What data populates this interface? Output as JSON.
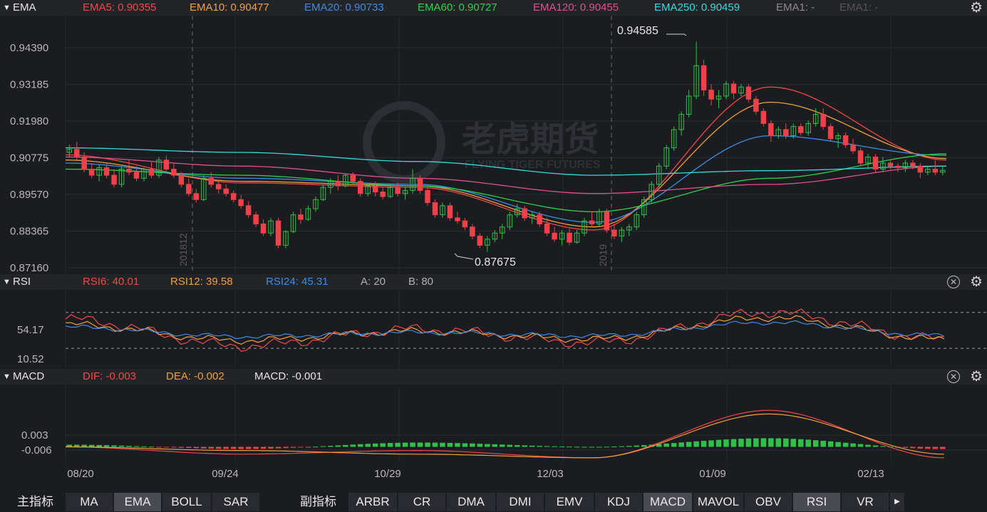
{
  "main_panel": {
    "name": "EMA",
    "indicators": [
      {
        "label": "EMA5: 0.90355",
        "color": "#f04848"
      },
      {
        "label": "EMA10: 0.90477",
        "color": "#f0a03c"
      },
      {
        "label": "EMA20: 0.90733",
        "color": "#3c8ce6"
      },
      {
        "label": "EMA60: 0.90727",
        "color": "#2fd04a"
      },
      {
        "label": "EMA120: 0.90455",
        "color": "#e0508c"
      },
      {
        "label": "EMA250: 0.90459",
        "color": "#38d8e0"
      },
      {
        "label": "EMA1: -",
        "color": "#8a8a8a"
      },
      {
        "label": "EMA1: -",
        "color": "#555555"
      }
    ],
    "y_ticks": [
      "0.94390",
      "0.93185",
      "0.91980",
      "0.90775",
      "0.89570",
      "0.88365",
      "0.87160"
    ],
    "high_label": "0.94585",
    "low_label": "0.87675",
    "year_markers": [
      "201812",
      "2019"
    ],
    "watermark_cn": "老虎期货",
    "watermark_en": "FLYING TIGER FUTURES"
  },
  "rsi_panel": {
    "name": "RSI",
    "labels": [
      {
        "label": "RSI6: 40.01",
        "color": "#f04848"
      },
      {
        "label": "RSI12: 39.58",
        "color": "#f0a03c"
      },
      {
        "label": "RSI24: 45.31",
        "color": "#3c8ce6"
      },
      {
        "label": "A: 20",
        "color": "#b0b0b0"
      },
      {
        "label": "B: 80",
        "color": "#b0b0b0"
      }
    ],
    "y_ticks": [
      "54.17",
      "10.52"
    ]
  },
  "macd_panel": {
    "name": "MACD",
    "labels": [
      {
        "label": "DIF: -0.003",
        "color": "#f04848"
      },
      {
        "label": "DEA: -0.002",
        "color": "#f0a03c"
      },
      {
        "label": "MACD: -0.001",
        "color": "#e6e6e6"
      }
    ],
    "y_ticks": [
      "0.003",
      "-0.006"
    ]
  },
  "x_axis": [
    "08/20",
    "09/24",
    "10/29",
    "12/03",
    "01/09",
    "02/13"
  ],
  "bottom": {
    "main_label": "主指标",
    "main_buttons": [
      "MA",
      "EMA",
      "BOLL",
      "SAR"
    ],
    "main_active": "EMA",
    "sub_label": "副指标",
    "sub_buttons": [
      "ARBR",
      "CR",
      "DMA",
      "DMI",
      "EMV",
      "KDJ",
      "MACD",
      "MAVOL",
      "OBV",
      "RSI",
      "VR"
    ],
    "sub_active": [
      "MACD",
      "RSI"
    ],
    "more_icon": "play-right-icon"
  },
  "chart_data": [
    {
      "type": "line",
      "title": "EMA",
      "x": [
        "08/20",
        "09/24",
        "10/29",
        "12/03",
        "01/09",
        "02/13"
      ],
      "ylim": [
        0.8716,
        0.9499
      ],
      "series": [
        {
          "name": "EMA5",
          "values": [
            0.9087,
            0.8995,
            0.898,
            0.884,
            0.931,
            0.907
          ]
        },
        {
          "name": "EMA10",
          "values": [
            0.907,
            0.9,
            0.8985,
            0.885,
            0.926,
            0.9075
          ]
        },
        {
          "name": "EMA20",
          "values": [
            0.906,
            0.901,
            0.899,
            0.8865,
            0.915,
            0.9085
          ]
        },
        {
          "name": "EMA60",
          "values": [
            0.904,
            0.902,
            0.8985,
            0.89,
            0.901,
            0.909
          ]
        },
        {
          "name": "EMA120",
          "values": [
            0.908,
            0.905,
            0.901,
            0.896,
            0.899,
            0.905
          ]
        },
        {
          "name": "EMA250",
          "values": [
            0.911,
            0.9095,
            0.9065,
            0.902,
            0.9035,
            0.905
          ]
        }
      ],
      "high": 0.94585,
      "low": 0.87675,
      "candles": [
        [
          0.9095,
          0.912,
          0.908,
          0.9105
        ],
        [
          0.9105,
          0.913,
          0.907,
          0.908
        ],
        [
          0.908,
          0.9095,
          0.903,
          0.904
        ],
        [
          0.904,
          0.906,
          0.901,
          0.902
        ],
        [
          0.902,
          0.9055,
          0.9,
          0.9045
        ],
        [
          0.9045,
          0.906,
          0.901,
          0.902
        ],
        [
          0.902,
          0.904,
          0.898,
          0.899
        ],
        [
          0.899,
          0.905,
          0.898,
          0.904
        ],
        [
          0.904,
          0.907,
          0.902,
          0.903
        ],
        [
          0.903,
          0.905,
          0.9,
          0.901
        ],
        [
          0.901,
          0.9045,
          0.9,
          0.904
        ],
        [
          0.904,
          0.9065,
          0.901,
          0.902
        ],
        [
          0.902,
          0.908,
          0.901,
          0.907
        ],
        [
          0.907,
          0.9085,
          0.903,
          0.904
        ],
        [
          0.904,
          0.906,
          0.901,
          0.902
        ],
        [
          0.902,
          0.903,
          0.898,
          0.899
        ],
        [
          0.899,
          0.901,
          0.895,
          0.896
        ],
        [
          0.896,
          0.8975,
          0.893,
          0.894
        ],
        [
          0.894,
          0.902,
          0.8935,
          0.901
        ],
        [
          0.901,
          0.903,
          0.898,
          0.899
        ],
        [
          0.899,
          0.9,
          0.896,
          0.8975
        ],
        [
          0.8975,
          0.899,
          0.895,
          0.896
        ],
        [
          0.896,
          0.897,
          0.893,
          0.894
        ],
        [
          0.894,
          0.8955,
          0.891,
          0.892
        ],
        [
          0.892,
          0.8935,
          0.888,
          0.889
        ],
        [
          0.889,
          0.89,
          0.885,
          0.886
        ],
        [
          0.886,
          0.8875,
          0.882,
          0.883
        ],
        [
          0.883,
          0.888,
          0.882,
          0.887
        ],
        [
          0.887,
          0.888,
          0.878,
          0.879
        ],
        [
          0.879,
          0.884,
          0.878,
          0.8835
        ],
        [
          0.8835,
          0.89,
          0.883,
          0.889
        ],
        [
          0.889,
          0.891,
          0.886,
          0.8875
        ],
        [
          0.8875,
          0.892,
          0.887,
          0.891
        ],
        [
          0.891,
          0.895,
          0.89,
          0.894
        ],
        [
          0.894,
          0.899,
          0.8935,
          0.898
        ],
        [
          0.898,
          0.901,
          0.896,
          0.9
        ],
        [
          0.9,
          0.902,
          0.897,
          0.8985
        ],
        [
          0.8985,
          0.9025,
          0.898,
          0.902
        ],
        [
          0.902,
          0.903,
          0.899,
          0.9
        ],
        [
          0.9,
          0.901,
          0.895,
          0.896
        ],
        [
          0.896,
          0.899,
          0.895,
          0.8985
        ],
        [
          0.8985,
          0.9,
          0.895,
          0.8965
        ],
        [
          0.8965,
          0.898,
          0.894,
          0.895
        ],
        [
          0.895,
          0.899,
          0.8945,
          0.898
        ],
        [
          0.898,
          0.8995,
          0.895,
          0.896
        ],
        [
          0.896,
          0.898,
          0.894,
          0.897
        ],
        [
          0.897,
          0.904,
          0.896,
          0.901
        ],
        [
          0.901,
          0.902,
          0.896,
          0.897
        ],
        [
          0.897,
          0.898,
          0.892,
          0.893
        ],
        [
          0.893,
          0.894,
          0.888,
          0.889
        ],
        [
          0.889,
          0.893,
          0.888,
          0.892
        ],
        [
          0.892,
          0.893,
          0.887,
          0.888
        ],
        [
          0.888,
          0.89,
          0.886,
          0.887
        ],
        [
          0.887,
          0.888,
          0.884,
          0.885
        ],
        [
          0.885,
          0.886,
          0.881,
          0.882
        ],
        [
          0.882,
          0.883,
          0.878,
          0.879
        ],
        [
          0.879,
          0.882,
          0.8768,
          0.881
        ],
        [
          0.881,
          0.884,
          0.88,
          0.883
        ],
        [
          0.883,
          0.886,
          0.881,
          0.885
        ],
        [
          0.885,
          0.89,
          0.884,
          0.889
        ],
        [
          0.889,
          0.8925,
          0.888,
          0.891
        ],
        [
          0.891,
          0.892,
          0.887,
          0.888
        ],
        [
          0.888,
          0.89,
          0.886,
          0.889
        ],
        [
          0.889,
          0.89,
          0.885,
          0.886
        ],
        [
          0.886,
          0.888,
          0.882,
          0.883
        ],
        [
          0.883,
          0.885,
          0.88,
          0.881
        ],
        [
          0.881,
          0.884,
          0.879,
          0.883
        ],
        [
          0.883,
          0.8845,
          0.879,
          0.88
        ],
        [
          0.88,
          0.884,
          0.8795,
          0.883
        ],
        [
          0.883,
          0.888,
          0.882,
          0.887
        ],
        [
          0.887,
          0.89,
          0.885,
          0.886
        ],
        [
          0.886,
          0.891,
          0.885,
          0.89
        ],
        [
          0.89,
          0.891,
          0.883,
          0.884
        ],
        [
          0.884,
          0.886,
          0.881,
          0.882
        ],
        [
          0.882,
          0.885,
          0.88,
          0.884
        ],
        [
          0.884,
          0.886,
          0.882,
          0.885
        ],
        [
          0.885,
          0.89,
          0.884,
          0.889
        ],
        [
          0.889,
          0.895,
          0.888,
          0.894
        ],
        [
          0.894,
          0.9,
          0.893,
          0.899
        ],
        [
          0.899,
          0.906,
          0.898,
          0.905
        ],
        [
          0.905,
          0.912,
          0.904,
          0.911
        ],
        [
          0.911,
          0.918,
          0.91,
          0.917
        ],
        [
          0.917,
          0.923,
          0.915,
          0.922
        ],
        [
          0.922,
          0.93,
          0.921,
          0.928
        ],
        [
          0.928,
          0.9459,
          0.927,
          0.938
        ],
        [
          0.938,
          0.94,
          0.928,
          0.93
        ],
        [
          0.93,
          0.932,
          0.925,
          0.927
        ],
        [
          0.927,
          0.93,
          0.924,
          0.928
        ],
        [
          0.928,
          0.933,
          0.927,
          0.932
        ],
        [
          0.932,
          0.933,
          0.927,
          0.929
        ],
        [
          0.929,
          0.932,
          0.928,
          0.931
        ],
        [
          0.931,
          0.932,
          0.926,
          0.927
        ],
        [
          0.927,
          0.928,
          0.922,
          0.923
        ],
        [
          0.923,
          0.924,
          0.918,
          0.919
        ],
        [
          0.919,
          0.92,
          0.913,
          0.915
        ],
        [
          0.915,
          0.918,
          0.914,
          0.917
        ],
        [
          0.917,
          0.919,
          0.914,
          0.915
        ],
        [
          0.915,
          0.919,
          0.914,
          0.918
        ],
        [
          0.918,
          0.919,
          0.915,
          0.916
        ],
        [
          0.916,
          0.92,
          0.915,
          0.919
        ],
        [
          0.919,
          0.924,
          0.918,
          0.922
        ],
        [
          0.922,
          0.924,
          0.917,
          0.918
        ],
        [
          0.918,
          0.919,
          0.913,
          0.914
        ],
        [
          0.914,
          0.916,
          0.911,
          0.915
        ],
        [
          0.915,
          0.916,
          0.911,
          0.912
        ],
        [
          0.912,
          0.914,
          0.909,
          0.91
        ],
        [
          0.91,
          0.911,
          0.905,
          0.906
        ],
        [
          0.906,
          0.909,
          0.904,
          0.908
        ],
        [
          0.908,
          0.909,
          0.903,
          0.904
        ],
        [
          0.904,
          0.908,
          0.903,
          0.906
        ],
        [
          0.906,
          0.907,
          0.904,
          0.905
        ],
        [
          0.905,
          0.906,
          0.903,
          0.9045
        ],
        [
          0.9045,
          0.907,
          0.903,
          0.906
        ],
        [
          0.906,
          0.907,
          0.904,
          0.905
        ],
        [
          0.905,
          0.906,
          0.901,
          0.903
        ],
        [
          0.903,
          0.905,
          0.902,
          0.904
        ],
        [
          0.904,
          0.907,
          0.902,
          0.903
        ],
        [
          0.903,
          0.905,
          0.902,
          0.9036
        ]
      ]
    },
    {
      "type": "line",
      "title": "RSI",
      "x": [
        "08/20",
        "09/24",
        "10/29",
        "12/03",
        "01/09",
        "02/13"
      ],
      "ylim": [
        10.52,
        90
      ],
      "series": [
        {
          "name": "RSI6",
          "values": [
            70,
            30,
            55,
            35,
            80,
            40
          ]
        },
        {
          "name": "RSI12",
          "values": [
            62,
            38,
            52,
            40,
            72,
            39.58
          ]
        },
        {
          "name": "RSI24",
          "values": [
            58,
            44,
            50,
            45,
            65,
            45.31
          ]
        }
      ]
    },
    {
      "type": "bar",
      "title": "MACD",
      "x": [
        "08/20",
        "09/24",
        "10/29",
        "12/03",
        "01/09",
        "02/13"
      ],
      "ylim": [
        -0.007,
        0.011
      ],
      "series": [
        {
          "name": "DIF",
          "values": [
            0.0,
            -0.002,
            -0.001,
            -0.003,
            0.01,
            -0.003
          ]
        },
        {
          "name": "DEA",
          "values": [
            0.0,
            -0.001,
            -0.002,
            -0.003,
            0.009,
            -0.002
          ]
        },
        {
          "name": "MACD",
          "values": [
            0.001,
            -0.001,
            0.002,
            0.0,
            0.004,
            -0.001
          ]
        }
      ]
    }
  ]
}
